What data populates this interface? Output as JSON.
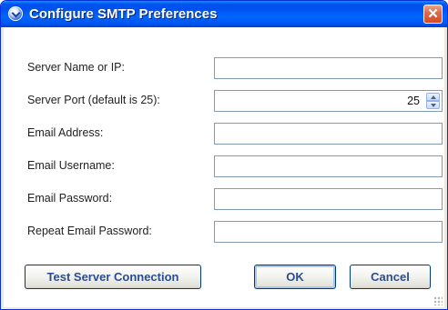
{
  "window": {
    "title": "Configure SMTP Preferences",
    "close_glyph": "✕"
  },
  "form": {
    "server_name": {
      "label": "Server Name or IP:",
      "value": ""
    },
    "server_port": {
      "label": "Server Port (default is 25):",
      "value": "25"
    },
    "email_address": {
      "label": "Email Address:",
      "value": ""
    },
    "email_username": {
      "label": "Email Username:",
      "value": ""
    },
    "email_password": {
      "label": "Email Password:",
      "value": ""
    },
    "repeat_password": {
      "label": "Repeat Email Password:",
      "value": ""
    }
  },
  "buttons": {
    "test_connection": "Test Server Connection",
    "ok": "OK",
    "cancel": "Cancel"
  },
  "colors": {
    "titlebar": "#0053ee",
    "window_border": "#0831d9",
    "button_text": "#2b4d8f"
  }
}
